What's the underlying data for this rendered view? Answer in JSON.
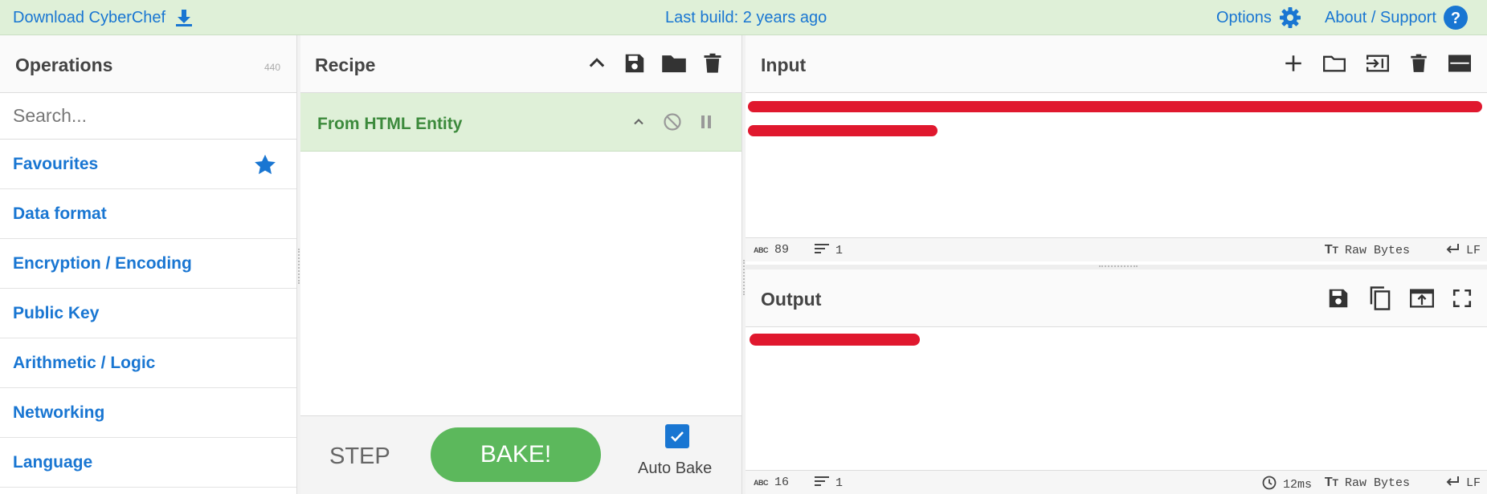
{
  "banner": {
    "download_label": "Download CyberChef",
    "last_build": "Last build: 2 years ago",
    "options_label": "Options",
    "about_label": "About / Support"
  },
  "operations": {
    "title": "Operations",
    "count": "440",
    "search_placeholder": "Search...",
    "categories": [
      {
        "label": "Favourites",
        "icon": "star-icon"
      },
      {
        "label": "Data format"
      },
      {
        "label": "Encryption / Encoding"
      },
      {
        "label": "Public Key"
      },
      {
        "label": "Arithmetic / Logic"
      },
      {
        "label": "Networking"
      },
      {
        "label": "Language"
      }
    ]
  },
  "recipe": {
    "title": "Recipe",
    "operation": "From HTML Entity",
    "step_label": "STEP",
    "bake_label": "BAKE!",
    "auto_bake_label": "Auto Bake",
    "auto_bake_checked": true
  },
  "input": {
    "title": "Input",
    "char_count": "89",
    "line_count": "1",
    "encoding": "Raw Bytes",
    "eol": "LF"
  },
  "output": {
    "title": "Output",
    "char_count": "16",
    "line_count": "1",
    "time": "12ms",
    "encoding": "Raw Bytes",
    "eol": "LF"
  },
  "colors": {
    "accent": "#1976d2",
    "banner_bg": "#dff0d8",
    "bake_green": "#5cb85c",
    "redaction": "#e0182e"
  }
}
